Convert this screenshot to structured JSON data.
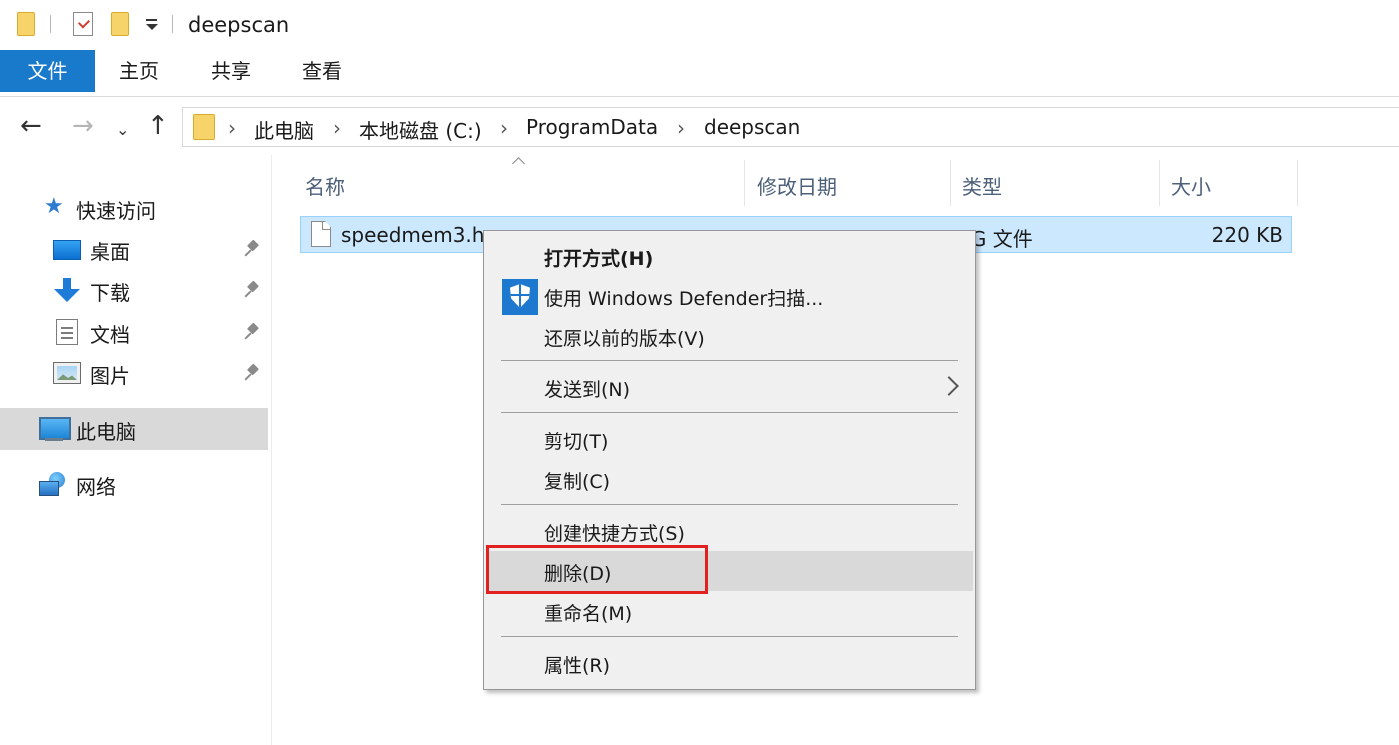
{
  "window": {
    "title": "deepscan"
  },
  "ribbon": {
    "tabs": [
      "文件",
      "主页",
      "共享",
      "查看"
    ]
  },
  "address": {
    "crumbs": [
      "此电脑",
      "本地磁盘 (C:)",
      "ProgramData",
      "deepscan"
    ]
  },
  "nav_pane": {
    "quick_access": "快速访问",
    "pinned": [
      {
        "label": "桌面",
        "icon": "desktop-icon"
      },
      {
        "label": "下载",
        "icon": "download-icon"
      },
      {
        "label": "文档",
        "icon": "documents-icon"
      },
      {
        "label": "图片",
        "icon": "pictures-icon"
      }
    ],
    "this_pc": "此电脑",
    "network": "网络"
  },
  "file_list": {
    "columns": [
      "名称",
      "修改日期",
      "类型",
      "大小"
    ],
    "rows": [
      {
        "name": "speedmem3.h",
        "type": "IG 文件",
        "size": "220 KB"
      }
    ]
  },
  "context_menu": {
    "items": [
      "打开方式(H)",
      "使用 Windows Defender扫描...",
      "还原以前的版本(V)",
      "发送到(N)",
      "剪切(T)",
      "复制(C)",
      "创建快捷方式(S)",
      "删除(D)",
      "重命名(M)",
      "属性(R)"
    ],
    "hovered_item": "删除(D)",
    "defender_icon": "shield-icon"
  },
  "colors": {
    "accent": "#1979ca",
    "selection": "#cce8ff",
    "highlight_box": "#e22020"
  }
}
